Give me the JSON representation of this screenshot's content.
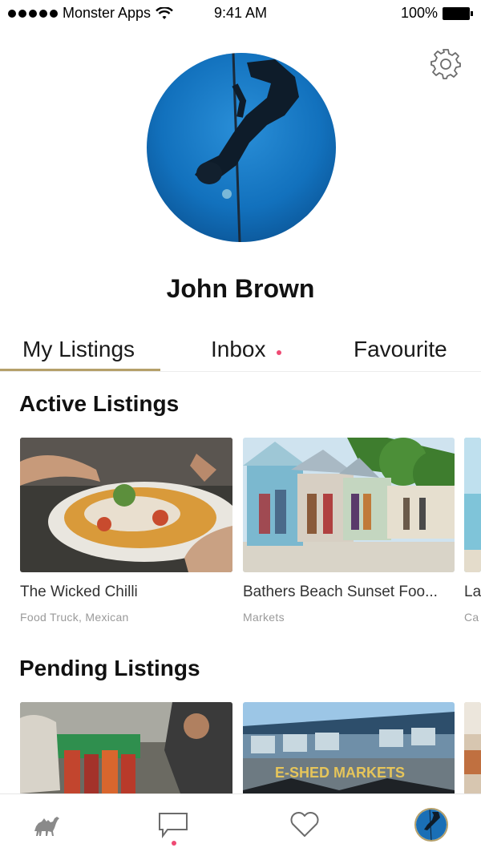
{
  "status_bar": {
    "carrier": "Monster Apps",
    "time": "9:41 AM",
    "battery": "100%"
  },
  "profile": {
    "name": "John Brown"
  },
  "tabs": [
    {
      "label": "My Listings",
      "active": true
    },
    {
      "label": "Inbox",
      "has_notification": true
    },
    {
      "label": "Favourite"
    }
  ],
  "sections": {
    "active_title": "Active Listings",
    "pending_title": "Pending Listings"
  },
  "active_listings": [
    {
      "title": "The Wicked Chilli",
      "subtitle": "Food Truck, Mexican"
    },
    {
      "title": "Bathers Beach Sunset Foo...",
      "subtitle": "Markets"
    },
    {
      "title": "La",
      "subtitle": "Ca"
    }
  ],
  "pending_listings": [
    {
      "sign_text": "E-SHED MARKETS"
    }
  ],
  "nav": {
    "items": [
      "camel-icon",
      "chat-icon",
      "heart-icon",
      "avatar"
    ]
  },
  "colors": {
    "accent": "#b5a06a",
    "notification": "#ef4a73",
    "icon_gray": "#8a8a8a"
  }
}
